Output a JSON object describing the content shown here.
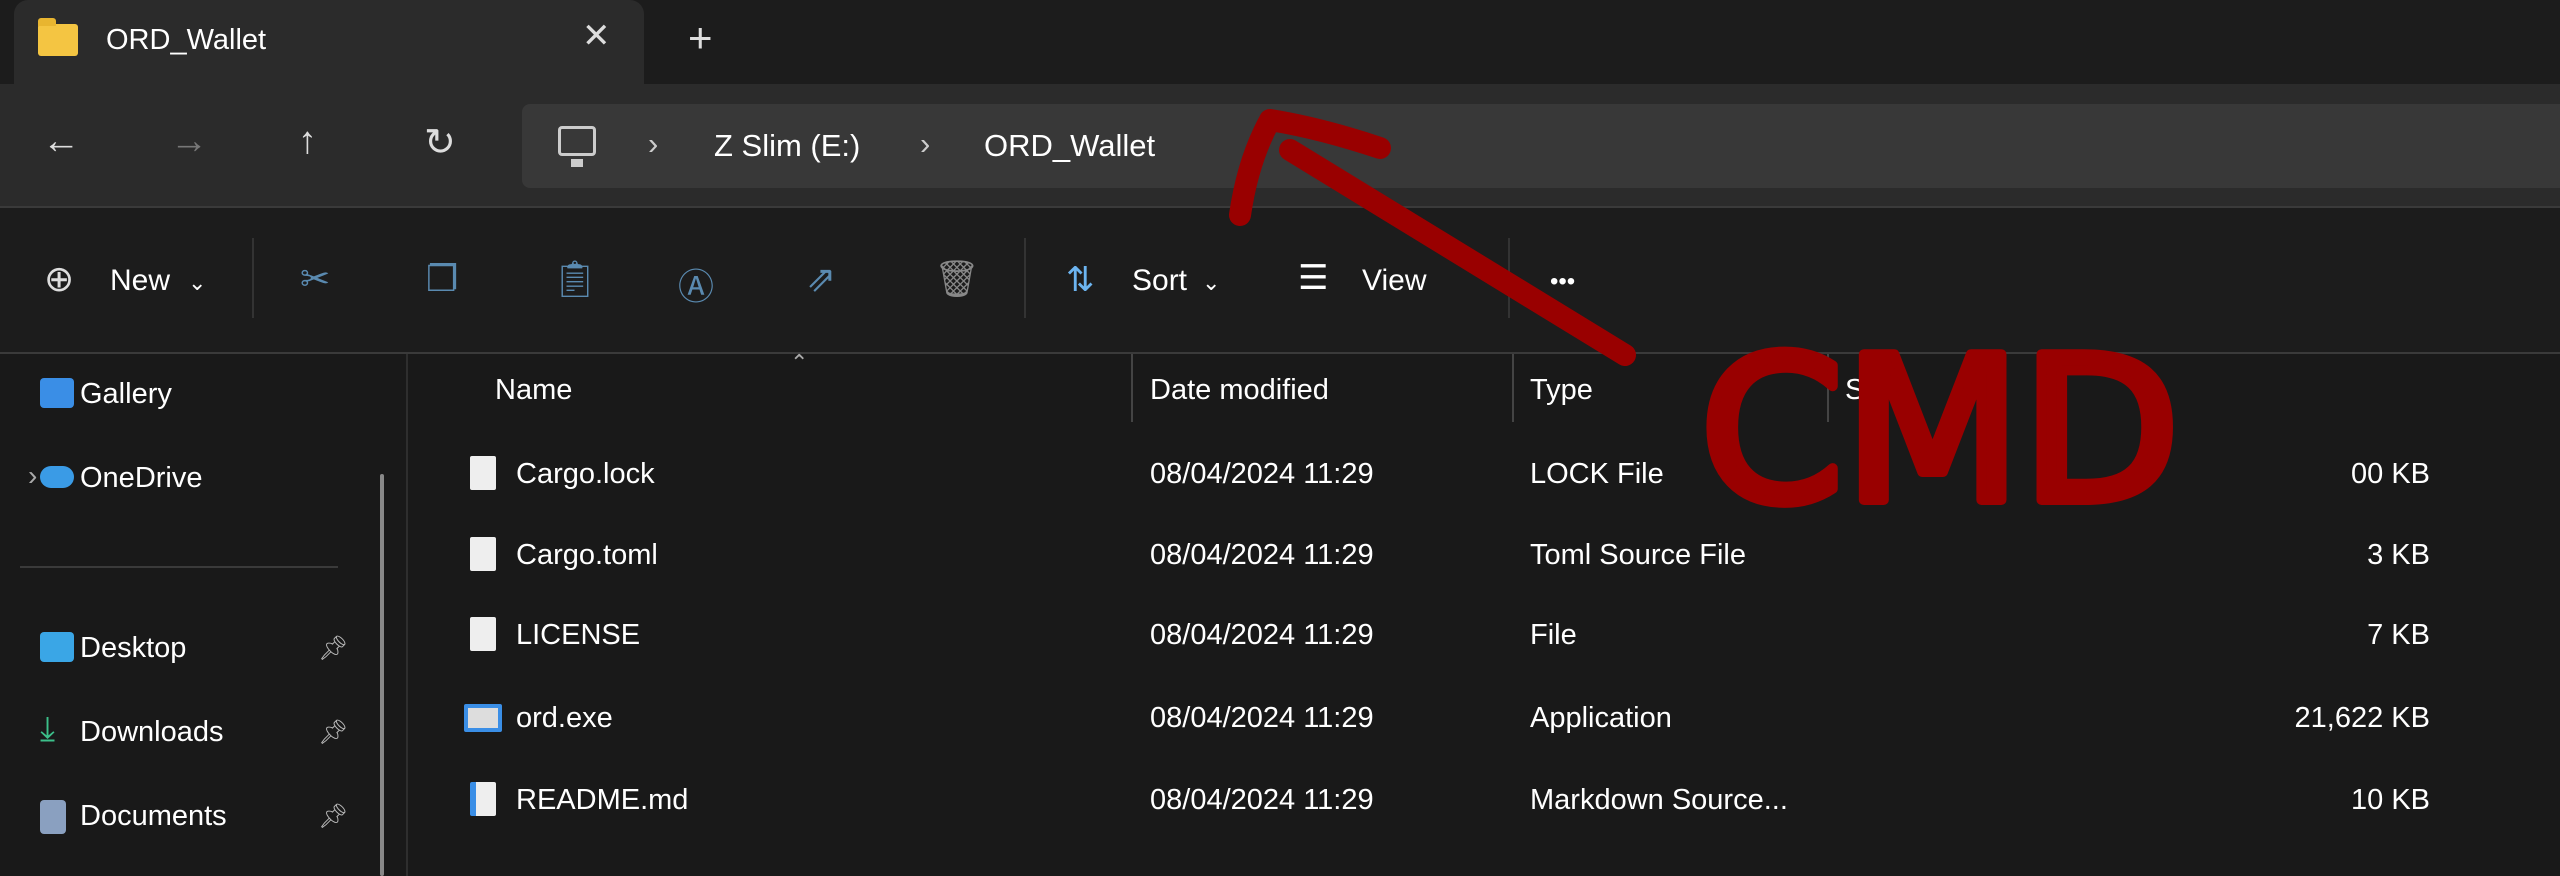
{
  "tab": {
    "title": "ORD_Wallet",
    "close_icon": "close-icon",
    "new_tab_icon": "plus-icon"
  },
  "nav": {
    "back": "←",
    "forward": "→",
    "up": "↑",
    "refresh": "↻"
  },
  "address": {
    "crumbs": [
      "Z Slim (E:)",
      "ORD_Wallet"
    ],
    "separator": "›"
  },
  "toolbar": {
    "new_label": "New",
    "sort_label": "Sort",
    "view_label": "View",
    "more": "•••",
    "chevron": "⌄"
  },
  "sidebar": {
    "items": [
      {
        "label": "Gallery",
        "icon": "gallery-icon",
        "color": "#3a8ee6"
      },
      {
        "label": "OneDrive",
        "icon": "cloud-icon",
        "color": "#3a9be6"
      },
      {
        "label": "Desktop",
        "icon": "desktop-icon",
        "color": "#3aa6e6",
        "pinned": true
      },
      {
        "label": "Downloads",
        "icon": "download-icon",
        "color": "#3cc08a",
        "pinned": true
      },
      {
        "label": "Documents",
        "icon": "document-icon",
        "color": "#8aa0c0",
        "pinned": true
      }
    ],
    "expand": "›",
    "pin": "📌"
  },
  "columns": [
    "Name",
    "Date modified",
    "Type",
    "Size"
  ],
  "files": [
    {
      "name": "Cargo.lock",
      "date": "08/04/2024 11:29",
      "type": "LOCK File",
      "size": "00 KB"
    },
    {
      "name": "Cargo.toml",
      "date": "08/04/2024 11:29",
      "type": "Toml Source File",
      "size": "3 KB"
    },
    {
      "name": "LICENSE",
      "date": "08/04/2024 11:29",
      "type": "File",
      "size": "7 KB"
    },
    {
      "name": "ord.exe",
      "date": "08/04/2024 11:29",
      "type": "Application",
      "size": "21,622 KB"
    },
    {
      "name": "README.md",
      "date": "08/04/2024 11:29",
      "type": "Markdown Source...",
      "size": "10 KB"
    }
  ],
  "annotation": {
    "text": "CMD",
    "color": "#990000"
  }
}
